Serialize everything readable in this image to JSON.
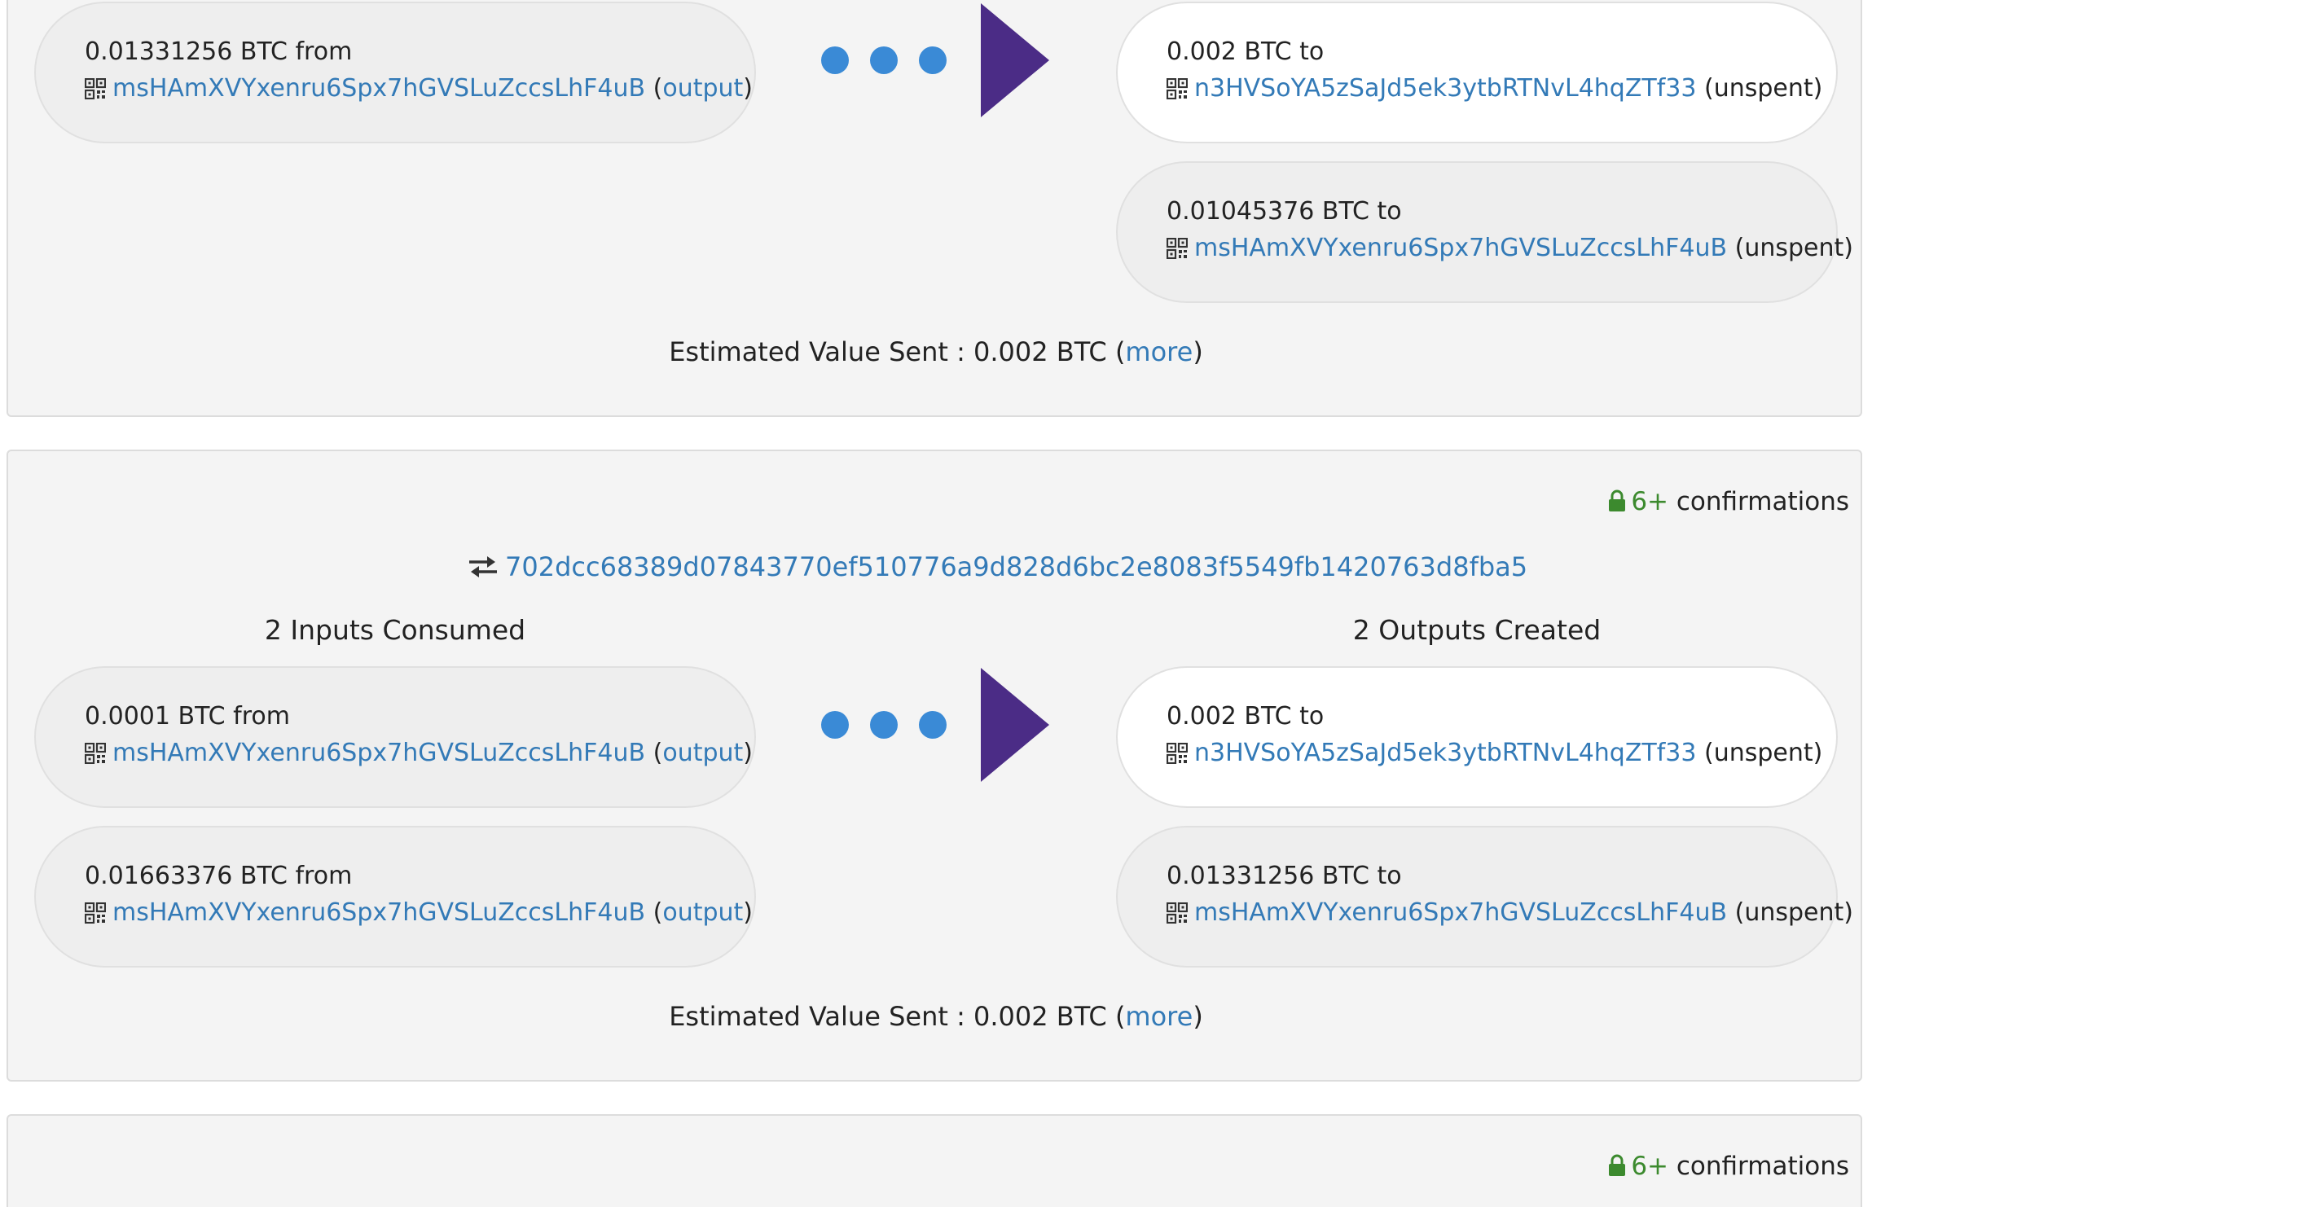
{
  "transactions": [
    {
      "inputs": [
        {
          "amount": "0.01331256 BTC",
          "word": "from",
          "address": "msHAmXVYxenru6Spx7hGVSLuZccsLhF4uB",
          "status": "output"
        }
      ],
      "outputs": [
        {
          "amount": "0.002 BTC",
          "word": "to",
          "address": "n3HVSoYA5zSaJd5ek3ytbRTNvL4hqZTf33",
          "status": "(unspent)"
        },
        {
          "amount": "0.01045376 BTC",
          "word": "to",
          "address": "msHAmXVYxenru6Spx7hGVSLuZccsLhF4uB",
          "status": "(unspent)"
        }
      ],
      "estimated": {
        "label": "Estimated Value Sent :",
        "value": "0.002 BTC",
        "more": "more"
      }
    },
    {
      "confirmations": {
        "count": "6+",
        "label": "confirmations"
      },
      "txid": "702dcc68389d07843770ef510776a9d828d6bc2e8083f5549fb1420763d8fba5",
      "inputs_header": "2 Inputs Consumed",
      "outputs_header": "2 Outputs Created",
      "inputs": [
        {
          "amount": "0.0001 BTC",
          "word": "from",
          "address": "msHAmXVYxenru6Spx7hGVSLuZccsLhF4uB",
          "status": "output"
        },
        {
          "amount": "0.01663376 BTC",
          "word": "from",
          "address": "msHAmXVYxenru6Spx7hGVSLuZccsLhF4uB",
          "status": "output"
        }
      ],
      "outputs": [
        {
          "amount": "0.002 BTC",
          "word": "to",
          "address": "n3HVSoYA5zSaJd5ek3ytbRTNvL4hqZTf33",
          "status": "(unspent)"
        },
        {
          "amount": "0.01331256 BTC",
          "word": "to",
          "address": "msHAmXVYxenru6Spx7hGVSLuZccsLhF4uB",
          "status": "(unspent)"
        }
      ],
      "estimated": {
        "label": "Estimated Value Sent :",
        "value": "0.002 BTC",
        "more": "more"
      }
    },
    {
      "confirmations": {
        "count": "6+",
        "label": "confirmations"
      }
    }
  ],
  "icons": {
    "address": "qr-code-icon",
    "confirmations": "lock-icon",
    "txid": "exchange-arrows-icon",
    "flow": "flow-arrow-icon"
  },
  "colors": {
    "link": "#337ab7",
    "confirmed": "#3c8a2e",
    "flow_dot": "#3a8ad6",
    "flow_arrow": "#4b2c86",
    "panel_bg": "#f4f4f4",
    "input_pill_bg": "#eeeeee",
    "highlight_pill_bg": "#ffffff"
  }
}
